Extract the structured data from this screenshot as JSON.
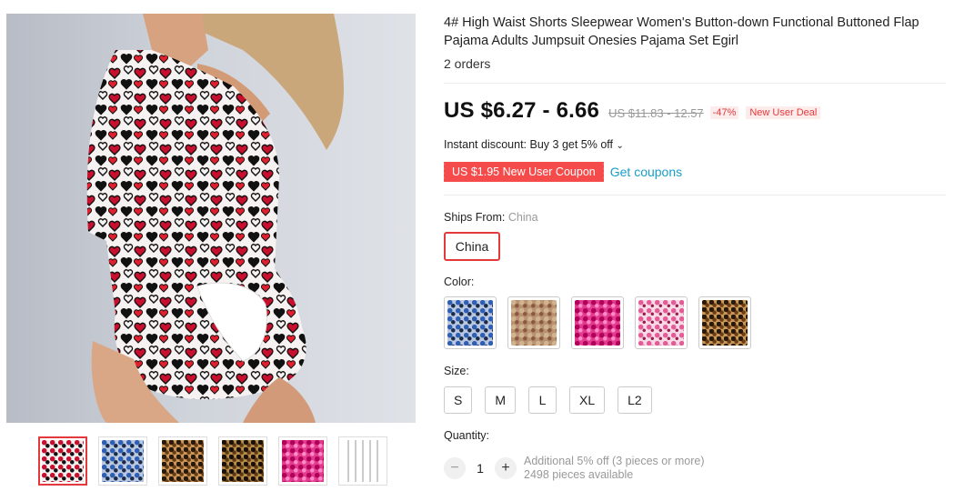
{
  "product": {
    "title": "4# High Waist Shorts Sleepwear Women's Button-down Functional Buttoned Flap Pajama Adults Jumpsuit Onesies Pajama Set Egirl",
    "orders": "2 orders"
  },
  "pricing": {
    "price": "US $6.27 - 6.66",
    "original_price": "US $11.83 - 12.57",
    "discount": "-47%",
    "deal_badge": "New User Deal",
    "instant_discount": "Instant discount: Buy 3 get 5% off",
    "coupon_label": "US $1.95 New User Coupon",
    "get_coupons": "Get coupons"
  },
  "shipping": {
    "label": "Ships From:",
    "selected": "China",
    "options": [
      "China"
    ]
  },
  "color": {
    "label": "Color:",
    "swatches": [
      {
        "icon": "blue-print-swatch"
      },
      {
        "icon": "brown-print-swatch"
      },
      {
        "icon": "pink-print-swatch"
      },
      {
        "icon": "light-pink-print-swatch"
      },
      {
        "icon": "leopard-print-swatch"
      }
    ]
  },
  "size": {
    "label": "Size:",
    "options": [
      "S",
      "M",
      "L",
      "XL",
      "L2"
    ]
  },
  "quantity": {
    "label": "Quantity:",
    "value": "1",
    "minus": "−",
    "plus": "+",
    "note_line1": "Additional 5% off (3 pieces or more)",
    "note_line2": "2498 pieces available"
  },
  "gallery": {
    "thumbnails": [
      {
        "icon": "red-heart-print-thumb",
        "active": true
      },
      {
        "icon": "blue-print-thumb",
        "active": false
      },
      {
        "icon": "leopard-print-thumb",
        "active": false
      },
      {
        "icon": "dark-leopard-print-thumb",
        "active": false
      },
      {
        "icon": "pink-print-thumb",
        "active": false
      },
      {
        "icon": "size-chart-thumb",
        "active": false
      }
    ]
  },
  "colors": {
    "accent": "#e4393c",
    "coupon_bg": "#f54b4b",
    "link": "#1a9ec7",
    "muted": "#999999"
  }
}
